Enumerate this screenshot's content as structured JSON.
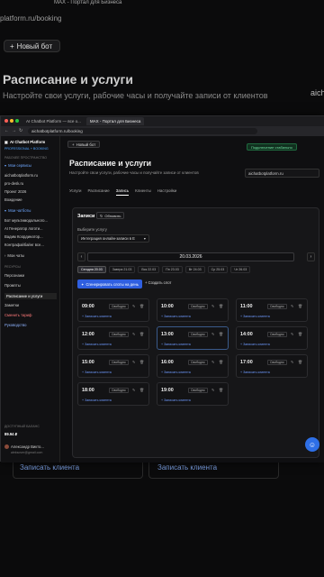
{
  "background": {
    "tab": "MAX - Портал для Бизнеса",
    "url": "platform.ru/booking",
    "new_bot": "Новый бот",
    "title": "Расписание и услуги",
    "subtitle": "Настройте свои услуги, рабочие часы и получайте записи от клиентов",
    "site": "aichatbotplatform.ru",
    "record_link": "Записать клиента"
  },
  "browser": {
    "tabs": [
      "AI Chatbot Platform — все о...",
      "MAX - Портал для Бизнеса"
    ],
    "url": "aichatbotplatform.ru/booking"
  },
  "sidebar": {
    "brand": "AI Chatbot Platform",
    "plan": "PROFESSIONAL + BOOKING",
    "section_workspace": "РАБОЧЕЕ ПРОСТРАНСТВО",
    "my_services": "Мои сервисы",
    "services": [
      "aichatbotplatform.ru",
      "pro-desk.ru",
      "Проект 2026",
      "Вождение"
    ],
    "my_chatbots": "Мои чатботы",
    "chatbots": [
      "Бот мультимодального...",
      "AI Генератор логоти...",
      "Вадим Координатор...",
      "Контрафайбайнг все..."
    ],
    "my_chats": "Мои чаты",
    "section_resources": "РЕСУРСЫ",
    "resources": [
      "Персонажи",
      "Промпты",
      "Расписание и услуги",
      "Заметки",
      "Сменить тариф",
      "Руководство"
    ],
    "balance_label": "ДОСТУПНЫЙ БАЛАНС",
    "balance": "89.94 ₽",
    "user_name": "Александр Викто...",
    "user_email": "aleksover@gmail.com"
  },
  "main": {
    "new_bot": "Новый бот",
    "status": "Подключение стабильно",
    "title": "Расписание и услуги",
    "subtitle": "Настройте свои услуги, рабочие часы и получайте записи от клиентов",
    "site": "aichatbotplatform.ru",
    "tabs": [
      "Услуги",
      "Расписание",
      "Запись",
      "Клиенты",
      "Настройки"
    ],
    "records_title": "Записи",
    "refresh": "Обновить",
    "choose_service": "Выберите услугу",
    "service": "Интеграция онлайн-записи в E",
    "date": "20.03.2026",
    "days": [
      "Сегодня 20.03",
      "Завтра 21.03",
      "Вск 22.03",
      "Пн 23.03",
      "Вт 24.03",
      "Ср 25.03",
      "Чт 26.03"
    ],
    "generate": "Сгенерировать слоты на день",
    "create_slot": "Создать слот",
    "free": "Свободно",
    "record": "+ Записать клиента",
    "slots": [
      "09:00",
      "10:00",
      "11:00",
      "12:00",
      "13:00",
      "14:00",
      "15:00",
      "16:00",
      "17:00",
      "18:00",
      "19:00"
    ]
  }
}
